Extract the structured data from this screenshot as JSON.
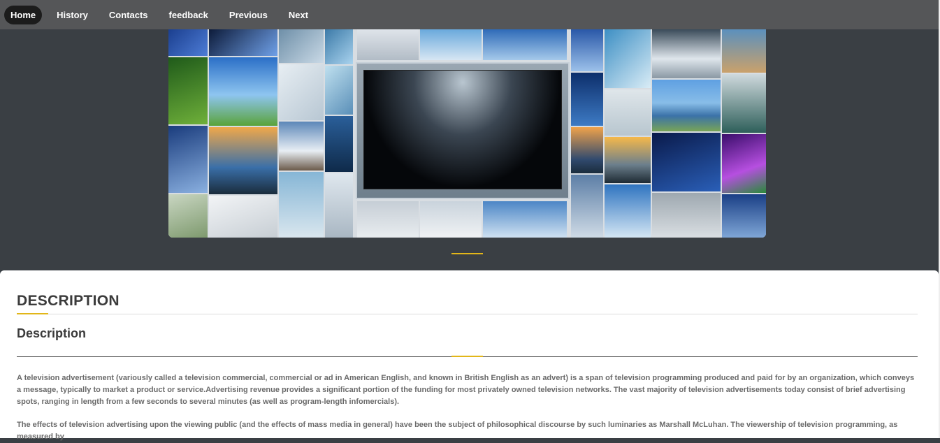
{
  "nav": {
    "items": [
      {
        "label": "Home",
        "active": true
      },
      {
        "label": "History",
        "active": false
      },
      {
        "label": "Contacts",
        "active": false
      },
      {
        "label": "feedback",
        "active": false
      },
      {
        "label": "Previous",
        "active": false
      },
      {
        "label": "Next",
        "active": false
      }
    ]
  },
  "hero": {
    "image": "tv-monitor-surrounded-by-photo-tiles"
  },
  "content": {
    "section_title": "DESCRIPTION",
    "subtitle": "Description",
    "paragraphs": [
      "A television advertisement (variously called a television commercial, commercial or ad in American English, and known in British English as an advert) is a span of television programming produced and paid for by an organization, which conveys a message, typically to market a product or service.Advertising revenue provides a significant portion of the funding for most privately owned television networks. The vast majority of television advertisements today consist of brief advertising spots, ranging in length from a few seconds to several minutes (as well as program-length infomercials).",
      "The effects of television advertising upon the viewing public (and the effects of mass media in general) have been the subject of philosophical discourse by such luminaries as Marshall McLuhan. The viewership of television programming, as measured by"
    ]
  },
  "colors": {
    "accent": "#e2b619",
    "nav_bg": "#555658",
    "hero_bg": "#3a3f44",
    "active_pill": "#1c1c1c"
  }
}
